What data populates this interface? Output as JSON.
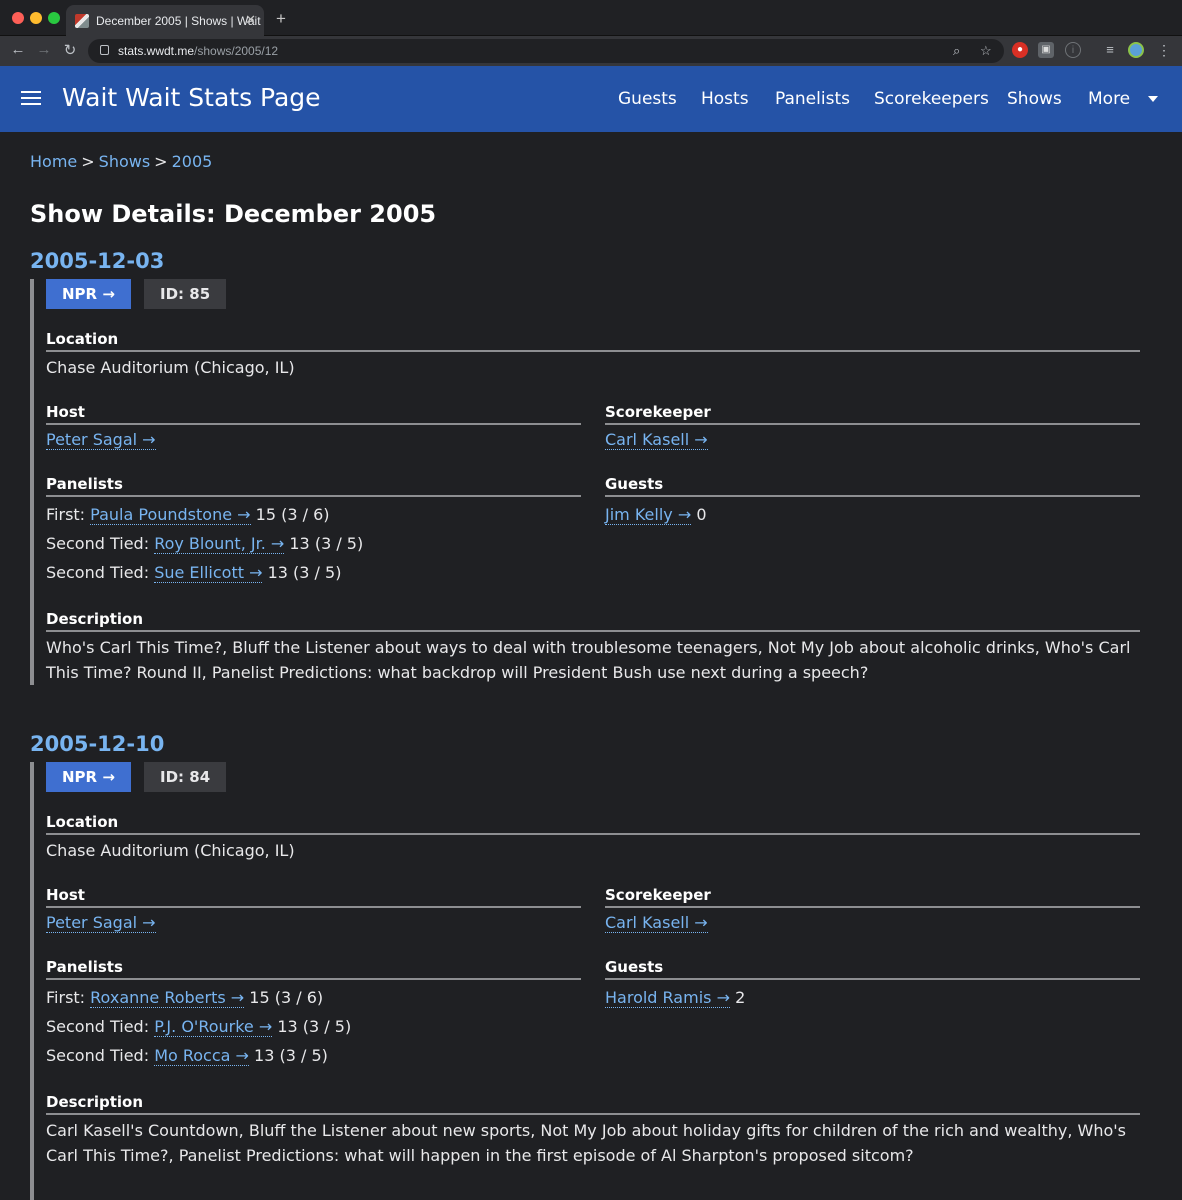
{
  "browser": {
    "tab_title": "December 2005 | Shows | Wait",
    "tab_close": "✕",
    "new_tab": "+",
    "url_host": "stats.wwdt.me",
    "url_path": "/shows/2005/12",
    "back": "←",
    "forward": "→",
    "reload": "↻"
  },
  "header": {
    "title": "Wait Wait Stats Page",
    "nav": [
      "Guests",
      "Hosts",
      "Panelists",
      "Scorekeepers",
      "Shows",
      "More"
    ]
  },
  "breadcrumb": {
    "home": "Home",
    "shows": "Shows",
    "year": "2005",
    "sep": ">"
  },
  "page_title": "Show Details: December 2005",
  "labels": {
    "location": "Location",
    "host": "Host",
    "scorekeeper": "Scorekeeper",
    "panelists": "Panelists",
    "guests": "Guests",
    "description": "Description"
  },
  "shows": [
    {
      "date": "2005-12-03",
      "npr": "NPR →",
      "id": "ID: 85",
      "location": "Chase Auditorium (Chicago, IL)",
      "host": "Peter Sagal →",
      "scorekeeper": "Carl Kasell →",
      "panelists": [
        {
          "rank": "First:",
          "name": "Paula Poundstone →",
          "score": "15 (3 / 6)"
        },
        {
          "rank": "Second Tied:",
          "name": "Roy Blount, Jr. →",
          "score": "13 (3 / 5)"
        },
        {
          "rank": "Second Tied:",
          "name": "Sue Ellicott →",
          "score": "13 (3 / 5)"
        }
      ],
      "guest": {
        "name": "Jim Kelly →",
        "score": "0"
      },
      "description": "Who's Carl This Time?, Bluff the Listener about ways to deal with troublesome teenagers, Not My Job about alcoholic drinks, Who's Carl This Time? Round II, Panelist Predictions: what backdrop will President Bush use next during a speech?"
    },
    {
      "date": "2005-12-10",
      "npr": "NPR →",
      "id": "ID: 84",
      "location": "Chase Auditorium (Chicago, IL)",
      "host": "Peter Sagal →",
      "scorekeeper": "Carl Kasell →",
      "panelists": [
        {
          "rank": "First:",
          "name": "Roxanne Roberts →",
          "score": "15 (3 / 6)"
        },
        {
          "rank": "Second Tied:",
          "name": "P.J. O'Rourke →",
          "score": "13 (3 / 5)"
        },
        {
          "rank": "Second Tied:",
          "name": "Mo Rocca →",
          "score": "13 (3 / 5)"
        }
      ],
      "guest": {
        "name": "Harold Ramis →",
        "score": "2"
      },
      "description": "Carl Kasell's Countdown, Bluff the Listener about new sports, Not My Job about holiday gifts for children of the rich and wealthy, Who's Carl This Time?, Panelist Predictions: what will happen in the first episode of Al Sharpton's proposed sitcom?"
    }
  ]
}
